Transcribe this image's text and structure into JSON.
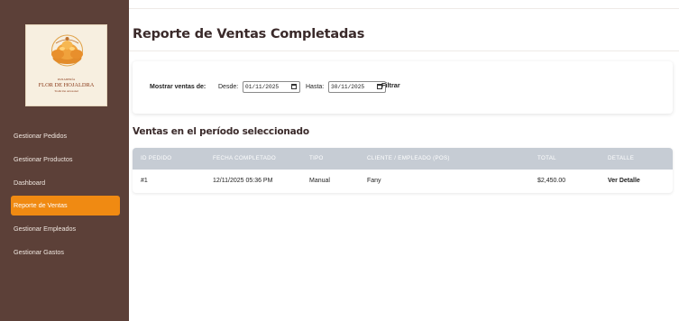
{
  "logo": {
    "top_small": "PANADERÍA",
    "name": "FLOR DE HOJALDRA",
    "tagline": "Tradición Artesanal"
  },
  "sidebar": {
    "items": [
      {
        "label": "Gestionar Pedidos",
        "active": false
      },
      {
        "label": "Gestionar Productos",
        "active": false
      },
      {
        "label": "Dashboard",
        "active": false
      },
      {
        "label": "Reporte de Ventas",
        "active": true
      },
      {
        "label": "Gestionar Empleados",
        "active": false
      },
      {
        "label": "Gestionar Gastos",
        "active": false
      }
    ]
  },
  "page": {
    "title": "Reporte de Ventas Completadas"
  },
  "filter": {
    "show_label": "Mostrar ventas de:",
    "from_label": "Desde:",
    "from_value": "01/11/2025",
    "to_label": "Hasta:",
    "to_value": "30/11/2025",
    "button_label": "Filtrar"
  },
  "sales": {
    "section_title": "Ventas en el período seleccionado",
    "columns": [
      "ID PEDIDO",
      "FECHA COMPLETADO",
      "TIPO",
      "CLIENTE / EMPLEADO (POS)",
      "TOTAL",
      "DETALLE"
    ],
    "rows": [
      {
        "id": "#1",
        "date": "12/11/2025 05:36 PM",
        "type": "Manual",
        "client": "Fany",
        "total": "$2,450.00",
        "detail": "Ver Detalle"
      }
    ]
  },
  "colors": {
    "sidebar_bg": "#5c4038",
    "accent": "#f08a12",
    "table_header_bg": "#c6ccd4",
    "logo_text": "#8a3b1a"
  }
}
